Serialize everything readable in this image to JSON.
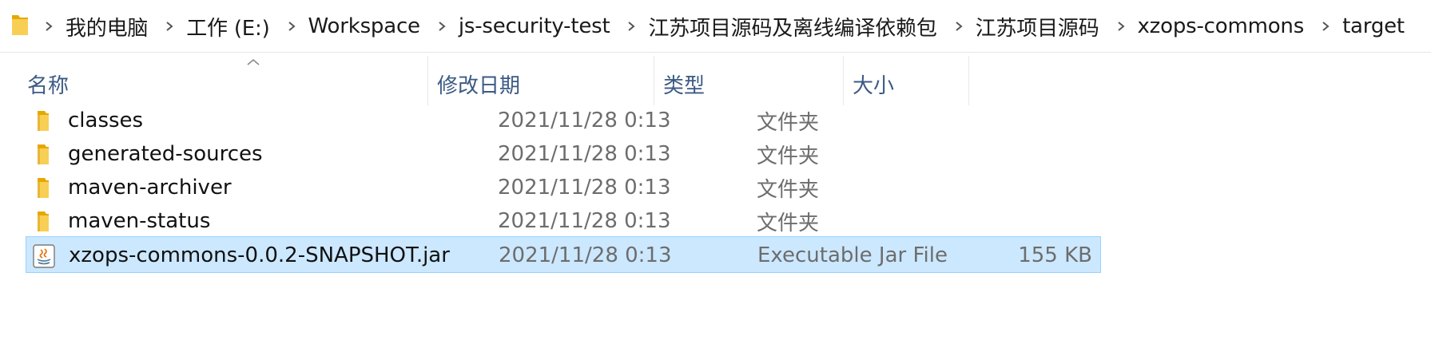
{
  "breadcrumb": {
    "icon": "folder-icon",
    "separator_icon": "chevron-right-icon",
    "items": [
      "我的电脑",
      "工作 (E:)",
      "Workspace",
      "js-security-test",
      "江苏项目源码及离线编译依赖包",
      "江苏项目源码",
      "xzops-commons",
      "target"
    ]
  },
  "columns": {
    "name": "名称",
    "date": "修改日期",
    "type": "类型",
    "size": "大小"
  },
  "sort": {
    "column": "name",
    "direction": "ascending",
    "icon": "sort-up-icon"
  },
  "files": [
    {
      "name": "classes",
      "modified": "2021/11/28 0:13",
      "type": "文件夹",
      "size": "",
      "icon": "folder-icon",
      "selected": false
    },
    {
      "name": "generated-sources",
      "modified": "2021/11/28 0:13",
      "type": "文件夹",
      "size": "",
      "icon": "folder-icon",
      "selected": false
    },
    {
      "name": "maven-archiver",
      "modified": "2021/11/28 0:13",
      "type": "文件夹",
      "size": "",
      "icon": "folder-icon",
      "selected": false
    },
    {
      "name": "maven-status",
      "modified": "2021/11/28 0:13",
      "type": "文件夹",
      "size": "",
      "icon": "folder-icon",
      "selected": false
    },
    {
      "name": "xzops-commons-0.0.2-SNAPSHOT.jar",
      "modified": "2021/11/28 0:13",
      "type": "Executable Jar File",
      "size": "155 KB",
      "icon": "java-jar-icon",
      "selected": true
    }
  ],
  "colors": {
    "header_text": "#3c5a84",
    "selection_bg": "#cce8ff",
    "selection_border": "#99d1ff",
    "folder_yellow": "#f8cf55"
  }
}
